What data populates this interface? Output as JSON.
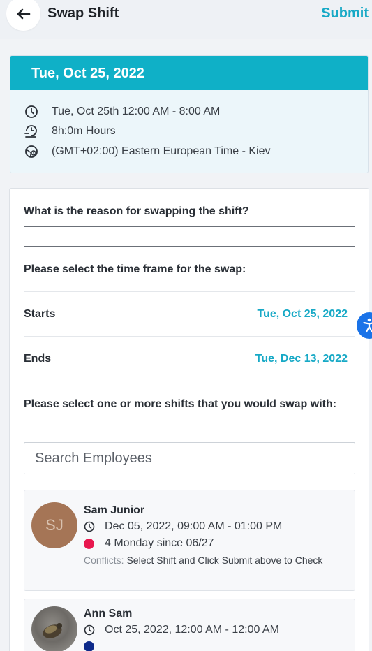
{
  "header": {
    "title": "Swap Shift",
    "submit_label": "Submit"
  },
  "shift": {
    "date_header": "Tue, Oct 25, 2022",
    "time_range": "Tue, Oct 25th 12:00 AM - 8:00 AM",
    "duration": "8h:0m Hours",
    "timezone": "(GMT+02:00) Eastern European Time - Kiev"
  },
  "form": {
    "reason_question": "What is the reason for swapping the shift?",
    "reason_value": "",
    "timeframe_question": "Please select the time frame for the swap:",
    "starts_label": "Starts",
    "starts_value": "Tue, Oct 25, 2022",
    "ends_label": "Ends",
    "ends_value": "Tue, Dec 13, 2022",
    "shifts_question": "Please select one or more shifts that you would swap with:",
    "search_placeholder": "Search Employees"
  },
  "employees": [
    {
      "initials": "SJ",
      "name": "Sam Junior",
      "shift_time": "Dec 05, 2022, 09:00 AM - 01:00 PM",
      "schedule": "4 Monday since 06/27",
      "dot_color": "#e8174e",
      "conflicts_label": "Conflicts:",
      "conflicts_text": "Select Shift and Click Submit above to Check"
    },
    {
      "name": "Ann Sam",
      "shift_time": "Oct 25, 2022, 12:00 AM - 12:00 AM",
      "dot_color": "#0d2a8a"
    }
  ],
  "colors": {
    "accent": "#17a9c6",
    "header_band": "#0fb0c7",
    "a11y_button": "#1a73e8"
  },
  "icons": {
    "back": "arrow-left-icon",
    "time": "clock-icon",
    "duration": "hourglass-timer-icon",
    "timezone": "globe-clock-icon",
    "accessibility": "accessibility-icon"
  }
}
